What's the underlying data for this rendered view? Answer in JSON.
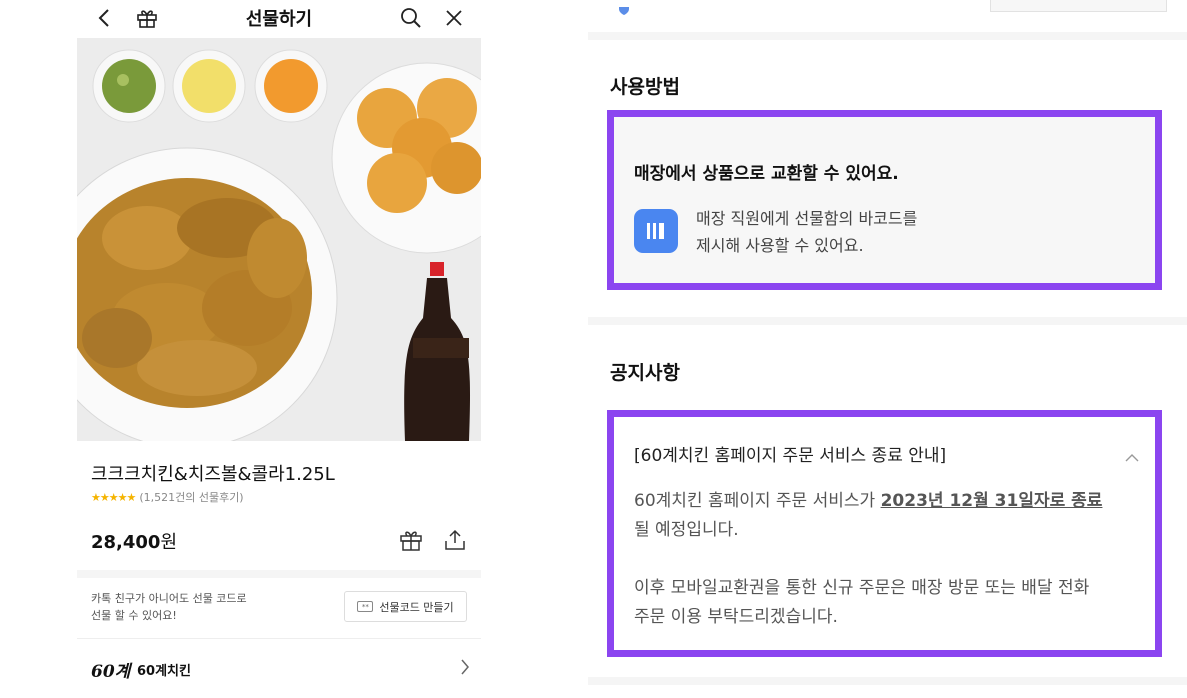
{
  "left": {
    "header": {
      "title": "선물하기",
      "back_icon": "back-arrow-icon",
      "gift_icon": "gift-box-icon",
      "search_icon": "search-icon",
      "close_icon": "close-icon"
    },
    "product": {
      "name": "크크크치킨&치즈볼&콜라1.25L",
      "rating_stars": 4.5,
      "review_count": "(1,521건의 선물후기)",
      "price_value": "28,400",
      "price_unit": "원"
    },
    "gift_code": {
      "desc_line1": "카톡 친구가 아니어도 선물 코드로",
      "desc_line2": "선물 할 수 있어요!",
      "button_label": "선물코드 만들기"
    },
    "brand": {
      "logo": "60계",
      "name": "60계치킨"
    }
  },
  "right": {
    "usage": {
      "title": "사용방법",
      "headline": "매장에서 상품으로 교환할 수 있어요.",
      "line1": "매장 직원에게 선물함의 바코드를",
      "line2": "제시해 사용할 수 있어요."
    },
    "notice": {
      "title": "공지사항",
      "item_title": "[60계치킨 홈페이지 주문 서비스 종료 안내]",
      "body_prefix": "60계치킨 홈페이지 주문 서비스가 ",
      "body_emphasis": "2023년 12월 31일자로 종료",
      "body_suffix": "될 예정입니다.",
      "body_line3": "이후 모바일교환권을 통한 신규 주문은 매장 방문 또는 배달 전화",
      "body_line4": "주문 이용 부탁드리겠습니다."
    }
  },
  "colors": {
    "highlight_border": "#8b45f0",
    "barcode_badge": "#4a86f0",
    "star": "#f5b400"
  }
}
